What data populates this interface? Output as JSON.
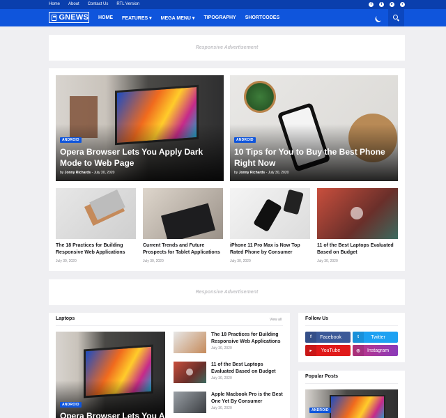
{
  "topbar": {
    "links": [
      "Home",
      "About",
      "Contact Us",
      "RTL Version"
    ]
  },
  "logo": {
    "text": "GNEWS"
  },
  "nav": {
    "items": [
      "HOME",
      "FEATURES ▾",
      "MEGA MENU ▾",
      "TIPOGRAPHY",
      "SHORTCODES"
    ]
  },
  "ads": {
    "label": "Responsive Advertisement"
  },
  "featured": [
    {
      "category": "ANDROID",
      "title": "Opera Browser Lets You Apply Dark Mode to Web Page",
      "author": "Jonny Richards",
      "date": "July 30, 2020"
    },
    {
      "category": "ANDROID",
      "title": "10 Tips for You to Buy the Best Phone Right Now",
      "author": "Jonny Richards",
      "date": "July 30, 2020"
    }
  ],
  "row_posts": [
    {
      "title": "The 18 Practices for Building Responsive Web Applications",
      "date": "July 30, 2020"
    },
    {
      "title": "Current Trends and Future Prospects for Tablet Applications",
      "date": "July 30, 2020"
    },
    {
      "title": "iPhone 11 Pro Max is Now Top Rated Phone by Consumer",
      "date": "July 30, 2020"
    },
    {
      "title": "11 of the Best Laptops Evaluated Based on Budget",
      "date": "July 30, 2020"
    }
  ],
  "laptops": {
    "title": "Laptops",
    "view_all": "View all",
    "main": {
      "category": "ANDROID",
      "title": "Opera Browser Lets You Apply"
    },
    "list": [
      {
        "title": "The 18 Practices for Building Responsive Web Applications",
        "date": "July 30, 2020"
      },
      {
        "title": "11 of the Best Laptops Evaluated Based on Budget",
        "date": "July 30, 2020"
      },
      {
        "title": "Apple Macbook Pro is the Best One Yet By Consumer",
        "date": "July 30, 2020"
      }
    ]
  },
  "follow": {
    "title": "Follow Us",
    "buttons": [
      {
        "label": "Facebook",
        "icon": "facebook-icon",
        "color": "#3b5998"
      },
      {
        "label": "Twitter",
        "icon": "twitter-icon",
        "color": "#1da1f2"
      },
      {
        "label": "YouTube",
        "icon": "youtube-icon",
        "color": "#e01a1a"
      },
      {
        "label": "Instagram",
        "icon": "instagram-icon",
        "color": "#c13584"
      }
    ]
  },
  "popular": {
    "title": "Popular Posts",
    "category": "ANDROID"
  }
}
